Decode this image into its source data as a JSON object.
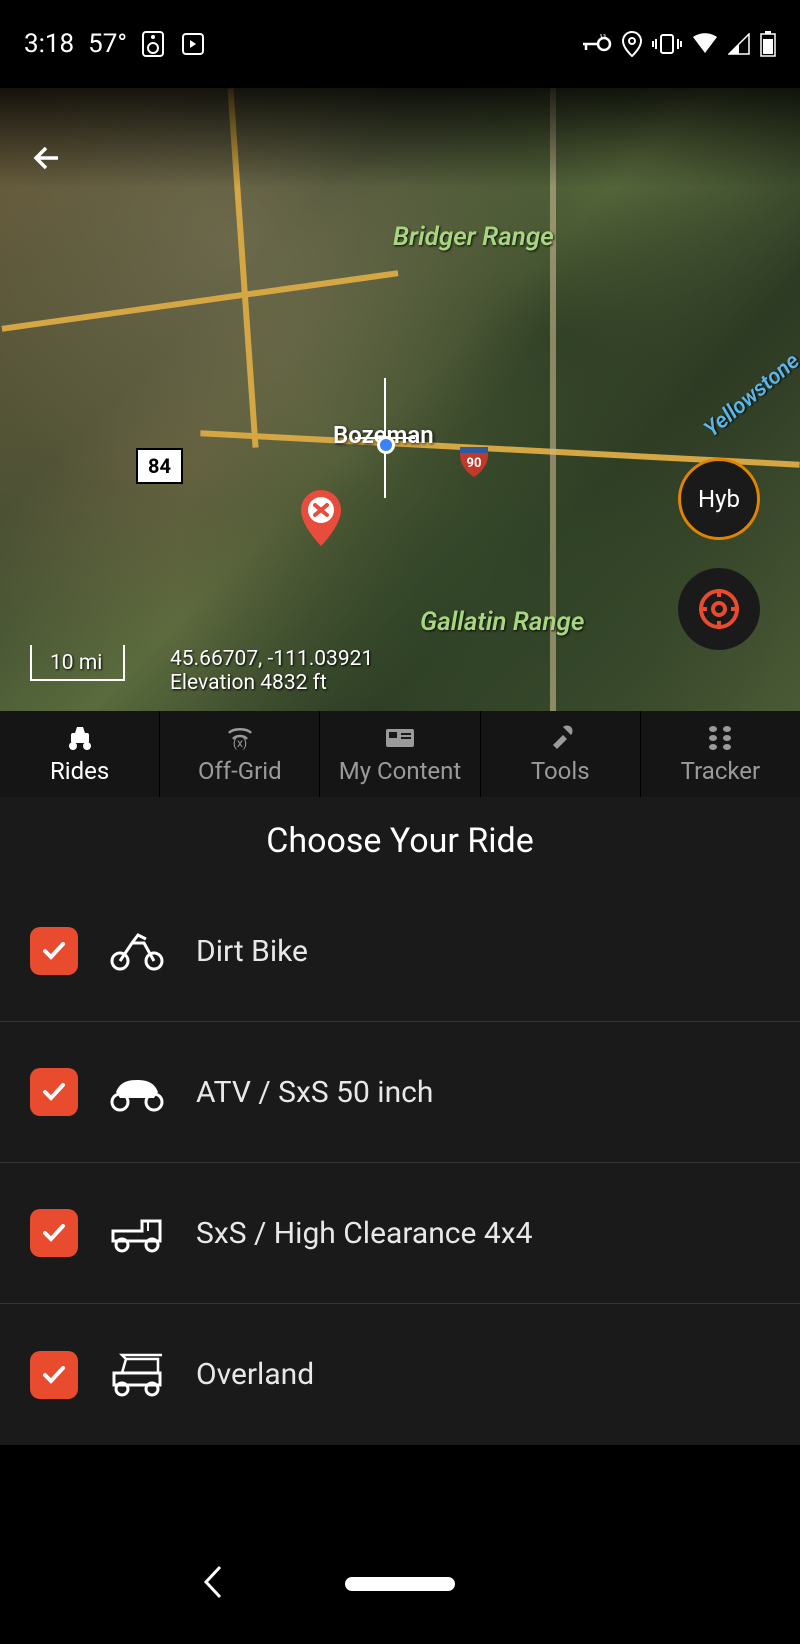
{
  "status": {
    "time": "3:18",
    "temp": "57°"
  },
  "map": {
    "labels": {
      "bridger": "Bridger Range",
      "gallatin": "Gallatin Range",
      "city": "Bozeman",
      "yellowstone": "Yellowstone"
    },
    "scale": "10 mi",
    "route_shield": "84",
    "interstate": "90",
    "coords": "45.66707, -111.03921",
    "elevation": "Elevation 4832 ft",
    "hyb_label": "Hyb"
  },
  "tabs": [
    {
      "label": "Rides",
      "active": true
    },
    {
      "label": "Off-Grid",
      "active": false
    },
    {
      "label": "My Content",
      "active": false
    },
    {
      "label": "Tools",
      "active": false
    },
    {
      "label": "Tracker",
      "active": false
    }
  ],
  "section_title": "Choose Your Ride",
  "rides": [
    {
      "label": "Dirt Bike",
      "checked": true
    },
    {
      "label": "ATV / SxS 50 inch",
      "checked": true
    },
    {
      "label": "SxS / High Clearance 4x4",
      "checked": true
    },
    {
      "label": "Overland",
      "checked": true
    }
  ]
}
